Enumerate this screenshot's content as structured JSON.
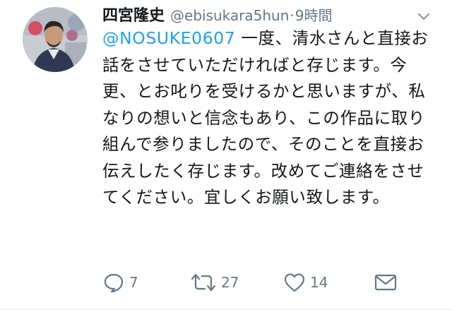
{
  "author": {
    "name": "四宮隆史",
    "handle": "@ebisukara5hun",
    "separator": "·",
    "time": "9時間"
  },
  "tweet": {
    "mention": "@NOSUKE0607",
    "text": " 一度、清水さんと直接お話をさせていただければと存じます。今更、とお叱りを受けるかと思いますが、私なりの想いと信念もあり、この作品に取り組んで参りましたので、そのことを直接お伝えしたく存じます。改めてご連絡をさせてください。宜しくお願い致します。"
  },
  "actions": {
    "reply_count": "7",
    "retweet_count": "27",
    "like_count": "14"
  },
  "colors": {
    "mention": "#1da1f2",
    "icon": "#657786",
    "text": "#14171a"
  },
  "icons": {
    "reply": "reply-icon",
    "retweet": "retweet-icon",
    "like": "heart-icon",
    "dm": "envelope-icon",
    "menu": "chevron-down-icon"
  }
}
